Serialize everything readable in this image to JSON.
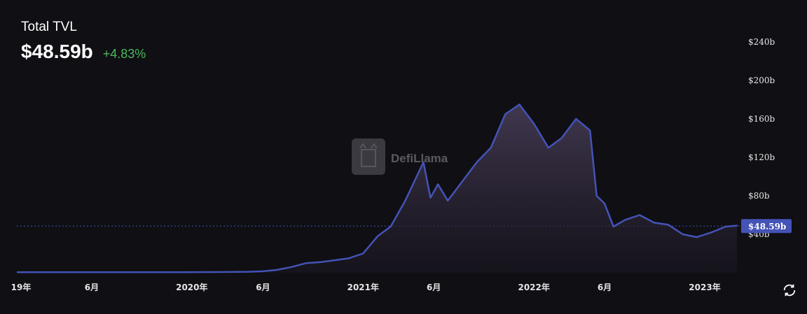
{
  "header": {
    "title": "Total TVL",
    "value": "$48.59b",
    "change": "+4.83%"
  },
  "watermark": {
    "text": "DefiLlama",
    "icon": "llama-logo-icon"
  },
  "colors": {
    "background": "#0f0f14",
    "line": "#4453b6",
    "positive": "#4cb85c",
    "label_badge": "#4453b6"
  },
  "current_label": "$48.59b",
  "icons": {
    "refresh": "refresh-icon"
  },
  "chart_data": {
    "type": "area",
    "title": "",
    "xlabel": "",
    "ylabel": "",
    "ylim": [
      0,
      240
    ],
    "y_unit": "$b",
    "y_ticks": [
      "$240b",
      "$200b",
      "$160b",
      "$120b",
      "$80b",
      "$40b"
    ],
    "y_tick_values": [
      240,
      200,
      160,
      120,
      80,
      40
    ],
    "x_ticks": [
      "19年",
      "6月",
      "2020年",
      "6月",
      "2021年",
      "6月",
      "2022年",
      "6月",
      "2023年"
    ],
    "x_tick_dates": [
      "2019-01-01",
      "2019-06-01",
      "2020-01-01",
      "2020-06-01",
      "2021-01-01",
      "2021-06-01",
      "2022-01-01",
      "2022-06-01",
      "2023-01-01"
    ],
    "grid": false,
    "series": [
      {
        "values": [
          [
            "2018-12-01",
            0.5
          ],
          [
            "2019-03-01",
            0.5
          ],
          [
            "2019-06-01",
            0.6
          ],
          [
            "2019-09-01",
            0.6
          ],
          [
            "2019-12-01",
            0.6
          ],
          [
            "2020-03-01",
            0.7
          ],
          [
            "2020-05-01",
            1.0
          ],
          [
            "2020-06-01",
            1.5
          ],
          [
            "2020-07-01",
            3
          ],
          [
            "2020-08-01",
            6
          ],
          [
            "2020-09-01",
            10
          ],
          [
            "2020-10-01",
            11
          ],
          [
            "2020-11-01",
            13
          ],
          [
            "2020-12-01",
            15
          ],
          [
            "2021-01-01",
            20
          ],
          [
            "2021-02-01",
            38
          ],
          [
            "2021-03-01",
            48
          ],
          [
            "2021-04-01",
            75
          ],
          [
            "2021-05-10",
            115
          ],
          [
            "2021-05-25",
            78
          ],
          [
            "2021-06-10",
            92
          ],
          [
            "2021-07-01",
            75
          ],
          [
            "2021-08-01",
            95
          ],
          [
            "2021-09-01",
            115
          ],
          [
            "2021-10-01",
            130
          ],
          [
            "2021-11-01",
            165
          ],
          [
            "2021-12-01",
            175
          ],
          [
            "2022-01-01",
            155
          ],
          [
            "2022-02-01",
            130
          ],
          [
            "2022-03-01",
            140
          ],
          [
            "2022-04-01",
            160
          ],
          [
            "2022-05-01",
            148
          ],
          [
            "2022-05-15",
            80
          ],
          [
            "2022-06-01",
            72
          ],
          [
            "2022-06-20",
            48
          ],
          [
            "2022-07-15",
            55
          ],
          [
            "2022-08-15",
            60
          ],
          [
            "2022-09-15",
            52
          ],
          [
            "2022-10-15",
            50
          ],
          [
            "2022-11-15",
            40
          ],
          [
            "2022-12-15",
            37
          ],
          [
            "2023-01-15",
            42
          ],
          [
            "2023-02-15",
            48
          ],
          [
            "2023-03-15",
            49
          ],
          [
            "2023-04-01",
            48.59
          ]
        ]
      }
    ]
  }
}
